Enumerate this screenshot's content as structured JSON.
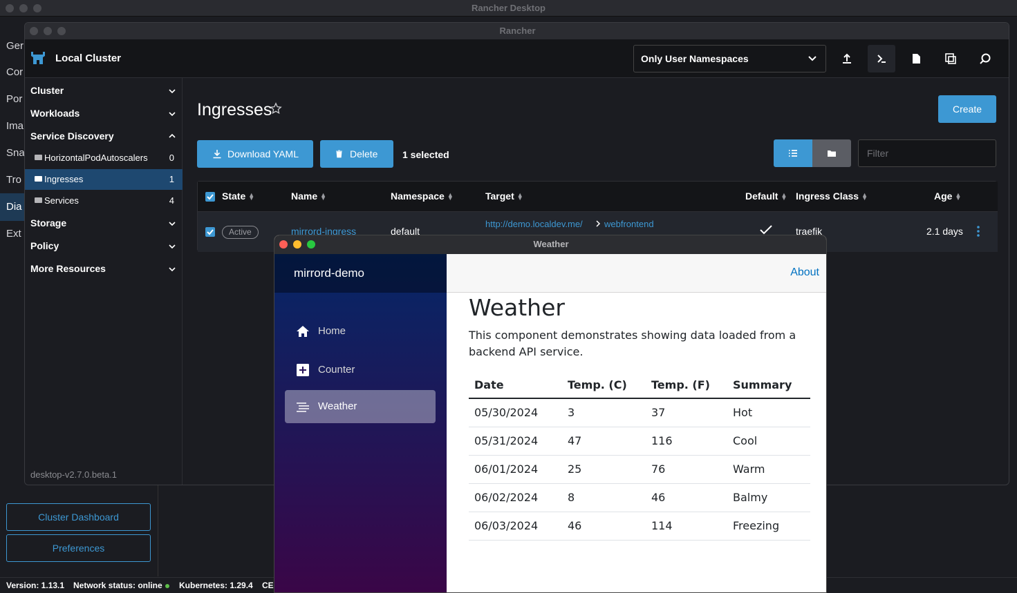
{
  "outer": {
    "title": "Rancher Desktop",
    "nav": [
      "Ger",
      "Cor",
      "Por",
      "Ima",
      "Sna",
      "Tro",
      "Dia",
      "Ext"
    ],
    "cluster_dashboard": "Cluster Dashboard",
    "preferences": "Preferences",
    "status": {
      "version": "Version: 1.13.1",
      "network": "Network status: online",
      "kubernetes": "Kubernetes: 1.29.4",
      "ce": "CE"
    }
  },
  "rancher": {
    "title": "Rancher",
    "cluster_name": "Local Cluster",
    "namespace_filter": "Only User Namespaces",
    "header_icons": [
      "upload-icon",
      "terminal-icon",
      "file-icon",
      "copy-icon",
      "search-icon"
    ],
    "sidebar": {
      "groups": [
        "Cluster",
        "Workloads",
        "Service Discovery",
        "Storage",
        "Policy",
        "More Resources"
      ],
      "items": [
        {
          "label": "HorizontalPodAutoscalers",
          "count": "0"
        },
        {
          "label": "Ingresses",
          "count": "1"
        },
        {
          "label": "Services",
          "count": "4"
        }
      ],
      "version": "desktop-v2.7.0.beta.1"
    },
    "page_title": "Ingresses",
    "create": "Create",
    "download_yaml": "Download YAML",
    "delete": "Delete",
    "selected": "1 selected",
    "filter_placeholder": "Filter",
    "columns": [
      "State",
      "Name",
      "Namespace",
      "Target",
      "Default",
      "Ingress Class",
      "Age"
    ],
    "row": {
      "state": "Active",
      "name": "mirrord-ingress",
      "namespace": "default",
      "target_url": "http://demo.localdev.me/",
      "target_service": "webfrontend",
      "ingress_class": "traefik",
      "age": "2.1 days"
    },
    "accent": "#3d98d3"
  },
  "weather_app": {
    "window_title": "Weather",
    "brand": "mirrord-demo",
    "nav": [
      "Home",
      "Counter",
      "Weather"
    ],
    "about": "About",
    "heading": "Weather",
    "description": "This component demonstrates showing data loaded from a backend API service.",
    "table": {
      "headers": [
        "Date",
        "Temp. (C)",
        "Temp. (F)",
        "Summary"
      ],
      "rows": [
        [
          "05/30/2024",
          "3",
          "37",
          "Hot"
        ],
        [
          "05/31/2024",
          "47",
          "116",
          "Cool"
        ],
        [
          "06/01/2024",
          "25",
          "76",
          "Warm"
        ],
        [
          "06/02/2024",
          "8",
          "46",
          "Balmy"
        ],
        [
          "06/03/2024",
          "46",
          "114",
          "Freezing"
        ]
      ]
    }
  }
}
